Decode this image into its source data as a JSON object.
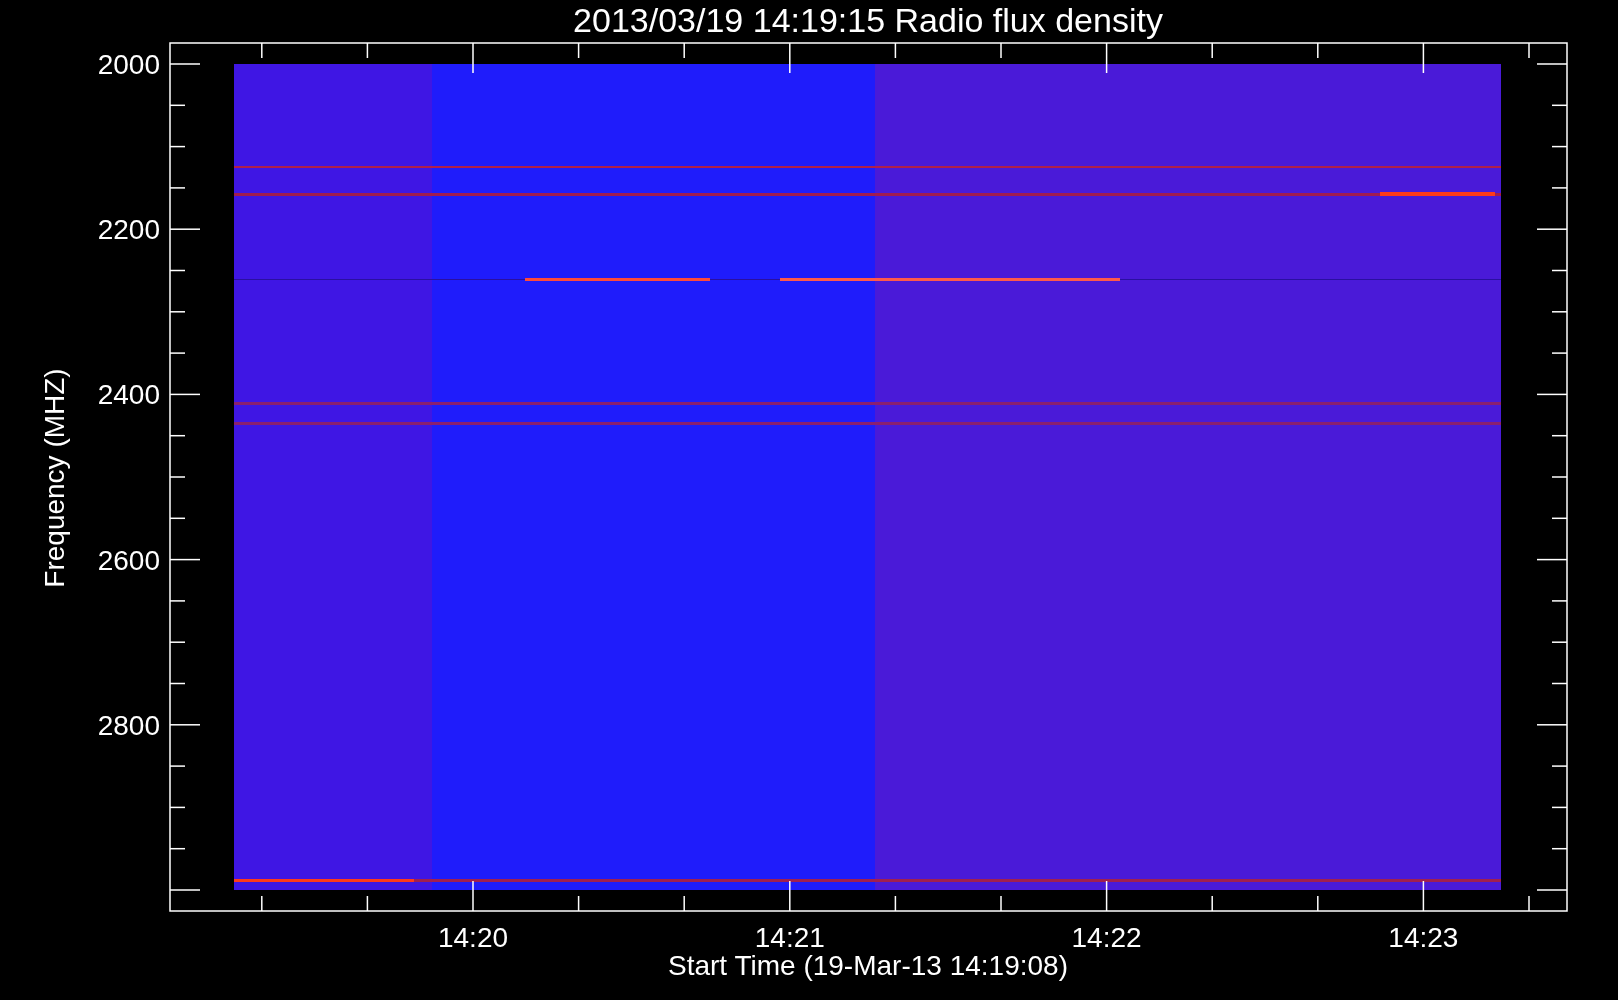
{
  "plot": {
    "title": "2013/03/19 14:19:15 Radio flux density",
    "ylabel": "Frequency (MHZ)",
    "xlabel": "Start Time (19-Mar-13 14:19:08)",
    "yticks": [
      "2000",
      "2200",
      "2400",
      "2600",
      "2800"
    ],
    "xticks": [
      "14:20",
      "14:21",
      "14:22",
      "14:23"
    ]
  }
}
